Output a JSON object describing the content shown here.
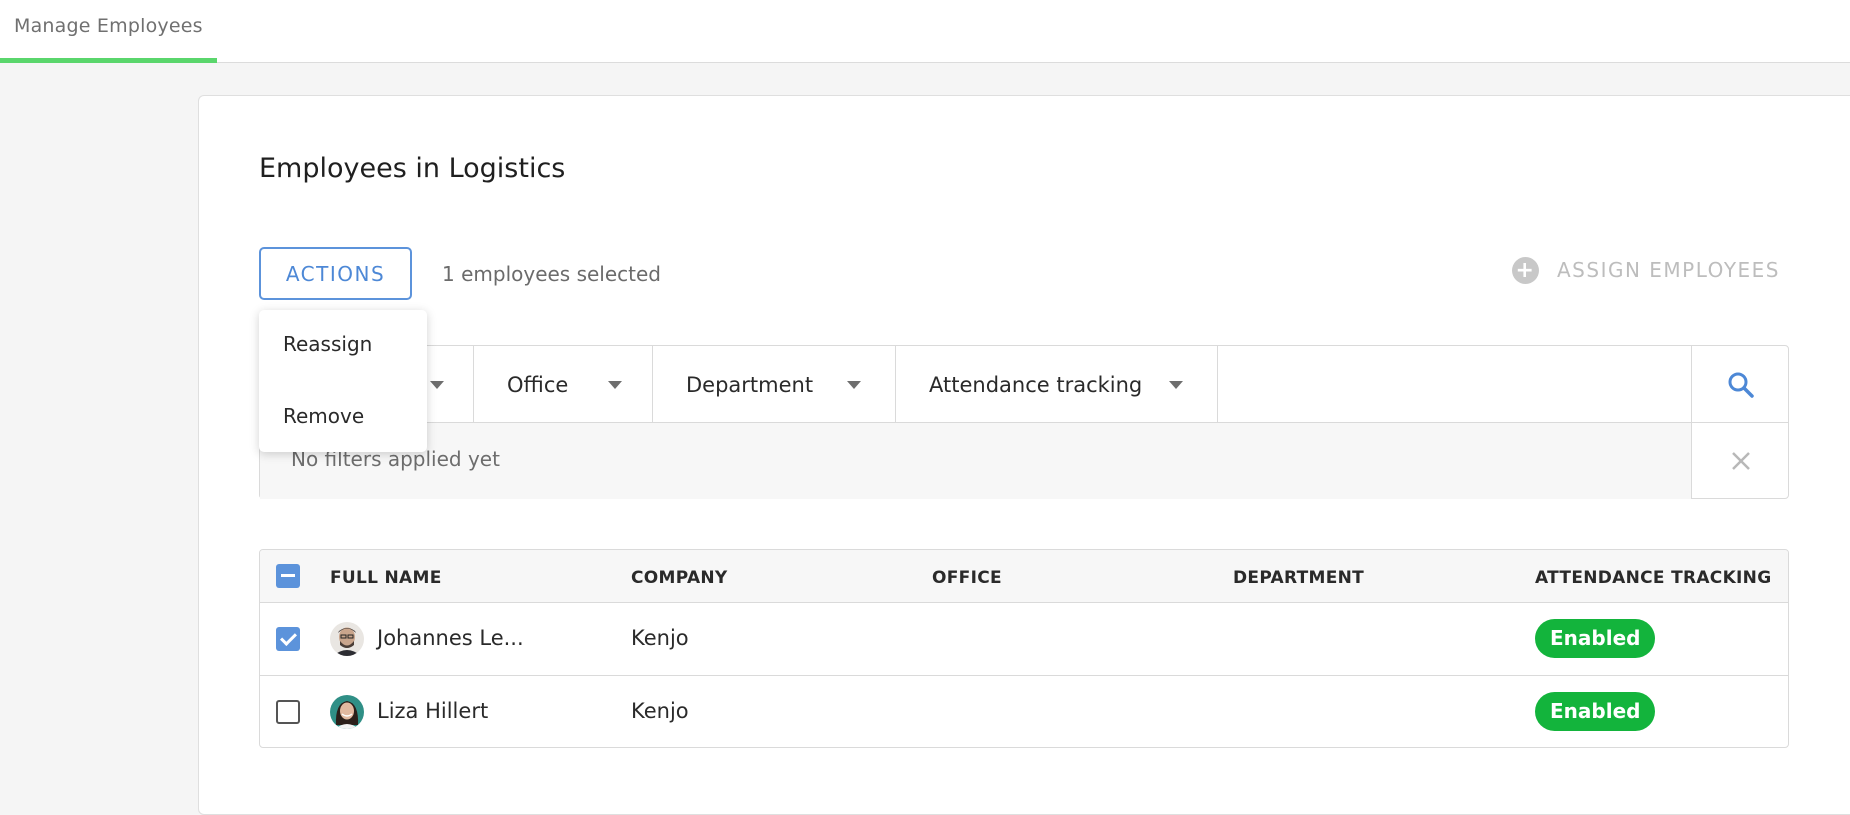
{
  "topbar": {
    "tab_label": "Manage Employees"
  },
  "page": {
    "title": "Employees in Logistics",
    "actions_label": "ACTIONS",
    "selected_text": "1 employees selected",
    "assign_label": "ASSIGN EMPLOYEES"
  },
  "actions_menu": {
    "items": [
      "Reassign",
      "Remove"
    ]
  },
  "filters": {
    "options": [
      "Office",
      "Department",
      "Attendance tracking"
    ],
    "status_text": "No filters applied yet"
  },
  "table": {
    "headers": [
      "FULL NAME",
      "COMPANY",
      "OFFICE",
      "DEPARTMENT",
      "ATTENDANCE TRACKING"
    ],
    "rows": [
      {
        "name": "Johannes Le...",
        "company": "Kenjo",
        "office": "",
        "department": "",
        "attendance": "Enabled",
        "selected": true
      },
      {
        "name": "Liza Hillert",
        "company": "Kenjo",
        "office": "",
        "department": "",
        "attendance": "Enabled",
        "selected": false
      }
    ]
  },
  "colors": {
    "accent": "#5c93db",
    "tab_underline": "#5ad66c",
    "enabled_badge": "#13b43c"
  },
  "icons": {
    "search": "search-icon",
    "clear": "close-icon",
    "plus": "plus-circle-icon",
    "caret": "caret-down-icon"
  }
}
